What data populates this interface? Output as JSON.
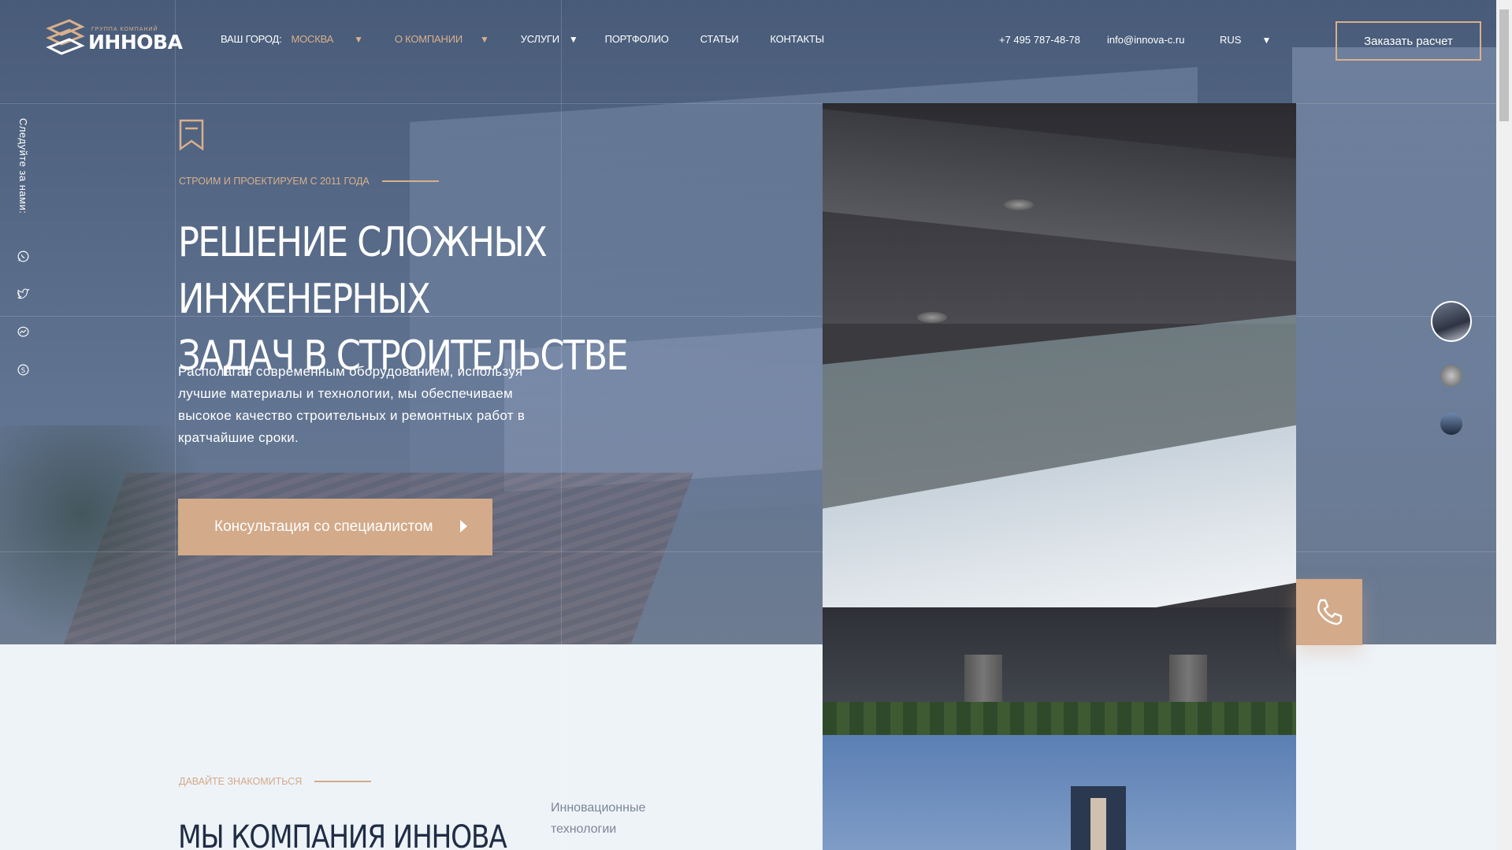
{
  "header": {
    "logo_sub": "ГРУППА КОМПАНИЙ",
    "logo_main": "ИННОВА",
    "city_label": "ВАШ ГОРОД:",
    "city_value": "МОСКВА",
    "nav": [
      {
        "label": "О КОМПАНИИ"
      },
      {
        "label": "УСЛУГИ"
      },
      {
        "label": "ПОРТФОЛИО"
      },
      {
        "label": "СТАТЬИ"
      },
      {
        "label": "КОНТАКТЫ"
      }
    ],
    "phone": "+7 495 787-48-78",
    "email": "info@innova-c.ru",
    "lang": "RUS",
    "order_label": "Заказать расчет"
  },
  "social": {
    "follow_label": "Следуйте за нами:",
    "icons": [
      "whatsapp-icon",
      "twitter-icon",
      "messenger-icon",
      "skype-icon"
    ]
  },
  "hero": {
    "tagline": "СТРОИМ И ПРОЕКТИРУЕМ С 2011 ГОДА",
    "title_line1": "РЕШЕНИЕ СЛОЖНЫХ ИНЖЕНЕРНЫХ",
    "title_line2": "ЗАДАЧ В СТРОИТЕЛЬСТВЕ",
    "description": "Располагая современным оборудованием, используя лучшие материалы и технологии, мы обеспечиваем высокое качество строительных и ремонтных работ в кратчайшие сроки.",
    "consult_label": "Консультация со специалистом"
  },
  "about": {
    "tag": "ДАВАЙТЕ ЗНАКОМИТЬСЯ",
    "title": "МЫ КОМПАНИЯ ИННОВА",
    "feature": "Инновационные технологии"
  },
  "colors": {
    "accent": "#d3aa8a",
    "hero_overlay": "#485e80",
    "dark_text": "#1f2d45"
  }
}
